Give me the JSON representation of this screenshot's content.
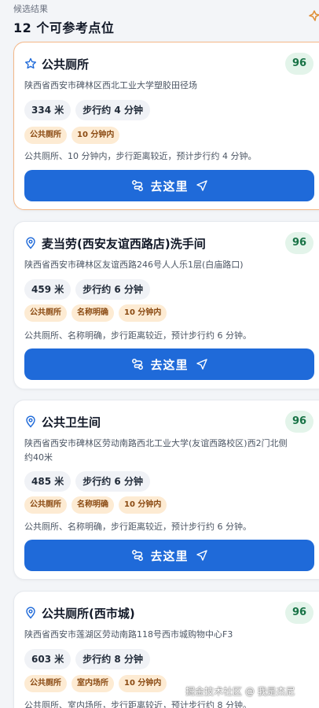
{
  "header": {
    "subtitle": "候选结果",
    "title": "12 个可参考点位"
  },
  "colors": {
    "accent": "#1f6ad9",
    "score_bg": "#e3f4ea",
    "score_text": "#177245",
    "tag_bg": "#fdebd3",
    "tag_text": "#8a4a12",
    "active_border": "#f4b788"
  },
  "results": [
    {
      "icon": "star-icon",
      "title": "公共厕所",
      "score": "96",
      "address": "陕西省西安市碑林区西北工业大学塑胶田径场",
      "distance": "334 米",
      "walk": "步行约 4 分钟",
      "tags": [
        "公共厕所",
        "10 分钟内"
      ],
      "summary": "公共厕所、10 分钟内，步行距离较近，预计步行约 4 分钟。",
      "button": "去这里"
    },
    {
      "icon": "location-pin-icon",
      "title": "麦当劳(西安友谊西路店)洗手间",
      "score": "96",
      "address": "陕西省西安市碑林区友谊西路246号人人乐1层(白庙路口)",
      "distance": "459 米",
      "walk": "步行约 6 分钟",
      "tags": [
        "公共厕所",
        "名称明确",
        "10 分钟内"
      ],
      "summary": "公共厕所、名称明确，步行距离较近，预计步行约 6 分钟。",
      "button": "去这里"
    },
    {
      "icon": "location-pin-icon",
      "title": "公共卫生间",
      "score": "96",
      "address": "陕西省西安市碑林区劳动南路西北工业大学(友谊西路校区)西2门北侧约40米",
      "distance": "485 米",
      "walk": "步行约 6 分钟",
      "tags": [
        "公共厕所",
        "名称明确",
        "10 分钟内"
      ],
      "summary": "公共厕所、名称明确，步行距离较近，预计步行约 6 分钟。",
      "button": "去这里"
    },
    {
      "icon": "location-pin-icon",
      "title": "公共厕所(西市城)",
      "score": "96",
      "address": "陕西省西安市莲湖区劳动南路118号西市城购物中心F3",
      "distance": "603 米",
      "walk": "步行约 8 分钟",
      "tags": [
        "公共厕所",
        "室内场所",
        "10 分钟内"
      ],
      "summary": "公共厕所、室内场所，步行距离较近，预计步行约 8 分钟。",
      "button": ""
    }
  ],
  "watermark": "掘金技术社区 @ 我是杰尼"
}
